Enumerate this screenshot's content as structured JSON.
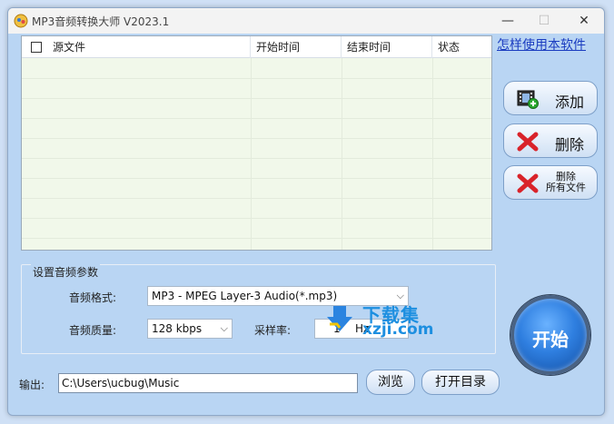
{
  "window": {
    "title": "MP3音频转换大师 V2023.1",
    "min_glyph": "—",
    "max_glyph": "☐",
    "close_glyph": "✕"
  },
  "file_list": {
    "columns": [
      "源文件",
      "开始时间",
      "结束时间",
      "状态"
    ]
  },
  "help_link": "怎样使用本软件",
  "buttons": {
    "add": "添加",
    "delete": "删除",
    "delete_all_line1": "删除",
    "delete_all_line2": "所有文件",
    "start": "开始",
    "browse": "浏览",
    "open_dir": "打开目录"
  },
  "params": {
    "title": "设置音频参数",
    "format_label": "音频格式:",
    "format_value": "MP3 - MPEG Layer-3 Audio(*.mp3)",
    "quality_label": "音频质量:",
    "quality_value": "128 kbps",
    "rate_label": "采样率:",
    "rate_value": "1",
    "rate_unit": "Hz"
  },
  "watermark": {
    "line1": "下载集",
    "line2": "xzji.com"
  },
  "output": {
    "label": "输出:",
    "path": "C:\\Users\\ucbug\\Music"
  },
  "icons": {
    "app": "app-icon",
    "add": "film-add-icon",
    "delete": "red-x-icon",
    "delete_all": "red-x-icon"
  },
  "colors": {
    "window_bg": "#b9d5f3",
    "list_bg": "#f1f8ea",
    "start_button": "#2f7fe0",
    "link": "#1a3cc0",
    "delete_icon": "#d9232a"
  }
}
